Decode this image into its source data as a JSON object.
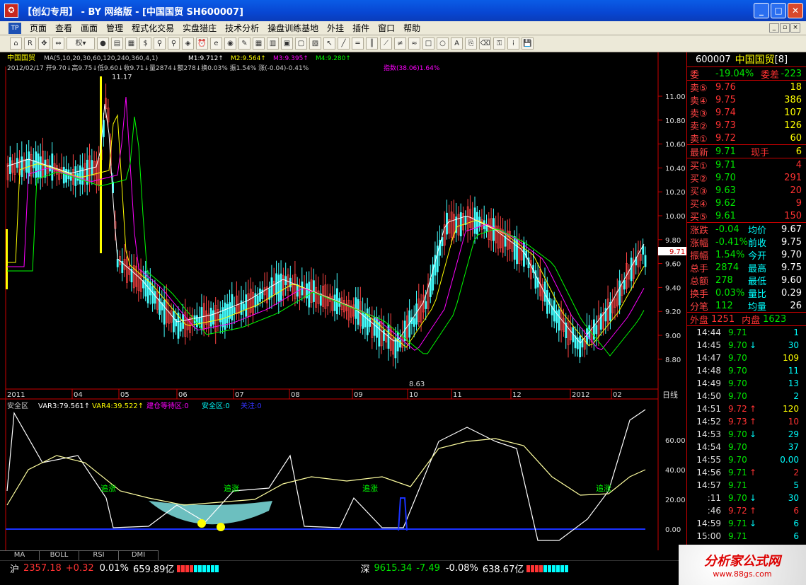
{
  "window": {
    "title": "【创幻专用】 - BY 网络版 - [中国国贸 SH600007]",
    "icon": "gear-app-icon"
  },
  "menu": [
    "页面",
    "查看",
    "画面",
    "管理",
    "程式化交易",
    "实盘猎庄",
    "技术分析",
    "操盘训练基地",
    "外挂",
    "插件",
    "窗口",
    "帮助"
  ],
  "toolbar": {
    "right_select": "权"
  },
  "main_header": {
    "line1_name": "中国国贸",
    "line1_ma": "MA(5,10,20,30,60,120,240,360,4,1)",
    "m1": "M1:9.712↑",
    "m2": "M2:9.564↑",
    "m3": "M3:9.395↑",
    "m4": "M4:9.280↑",
    "line2": "2012/02/17 开9.70↓高9.75↓低9.60↓收9.71↓量2874↓额278↓换0.03% 振1.54% 涨(-0.04)-0.41%",
    "line2_idx": "指数(38.06)1.64%"
  },
  "price_axis": [
    "11.00",
    "10.80",
    "10.60",
    "10.40",
    "10.20",
    "10.00",
    "9.80",
    "9.60",
    "9.40",
    "9.20",
    "9.00",
    "8.80"
  ],
  "price_tag": "9.71",
  "max_label": "11.17",
  "min_label": "8.63",
  "time_axis": [
    "2011",
    "04",
    "05",
    "06",
    "07",
    "08",
    "09",
    "10",
    "11",
    "12",
    "2012",
    "02"
  ],
  "period": "日线",
  "sub_header": {
    "name": "安全区",
    "var3": "VAR3:79.561↑",
    "var4": "VAR4:39.522↑",
    "wait": "建仓等待区:0",
    "safe": "安全区:0",
    "focus": "关注:0"
  },
  "sub_axis": [
    "60.00",
    "40.00",
    "20.00",
    "0.00"
  ],
  "sub_labels": [
    "追涨",
    "追涨",
    "追涨",
    "追涨"
  ],
  "tabs": [
    "MA",
    "BOLL",
    "RSI",
    "DMI"
  ],
  "quote": {
    "code": "600007",
    "name": "中国国贸",
    "tail": "[8]",
    "weibi_label": "委",
    "weibi": "-19.04%",
    "weicha_label": "委差",
    "weicha": "-223",
    "asks": [
      {
        "l": "卖⑤",
        "p": "9.76",
        "q": "18"
      },
      {
        "l": "卖④",
        "p": "9.75",
        "q": "386"
      },
      {
        "l": "卖③",
        "p": "9.74",
        "q": "107"
      },
      {
        "l": "卖②",
        "p": "9.73",
        "q": "126"
      },
      {
        "l": "卖①",
        "p": "9.72",
        "q": "60"
      }
    ],
    "last_label": "最新",
    "last": "9.71",
    "now_label": "现手",
    "now": "6",
    "bids": [
      {
        "l": "买①",
        "p": "9.71",
        "q": "4"
      },
      {
        "l": "买②",
        "p": "9.70",
        "q": "291"
      },
      {
        "l": "买③",
        "p": "9.63",
        "q": "20"
      },
      {
        "l": "买④",
        "p": "9.62",
        "q": "9"
      },
      {
        "l": "买⑤",
        "p": "9.61",
        "q": "150"
      }
    ],
    "stats": [
      [
        "涨跌",
        "-0.04",
        "均价",
        "9.67"
      ],
      [
        "涨幅",
        "-0.41%",
        "前收",
        "9.75"
      ],
      [
        "振幅",
        "1.54%",
        "今开",
        "9.70"
      ],
      [
        "总手",
        "2874",
        "最高",
        "9.75"
      ],
      [
        "总额",
        "278",
        "最低",
        "9.60"
      ],
      [
        "换手",
        "0.03%",
        "量比",
        "0.29"
      ],
      [
        "分笔",
        "112",
        "均量",
        "26"
      ]
    ],
    "outer_label": "外盘",
    "outer": "1251",
    "inner_label": "内盘",
    "inner": "1623",
    "ticks": [
      [
        "14:44",
        "9.71",
        "",
        "1"
      ],
      [
        "14:45",
        "9.70",
        "↓",
        "30"
      ],
      [
        "14:47",
        "9.70",
        "",
        "109"
      ],
      [
        "14:48",
        "9.70",
        "",
        "11"
      ],
      [
        "14:49",
        "9.70",
        "",
        "13"
      ],
      [
        "14:50",
        "9.70",
        "",
        "2"
      ],
      [
        "14:51",
        "9.72",
        "↑",
        "120"
      ],
      [
        "14:52",
        "9.73",
        "↑",
        "10"
      ],
      [
        "14:53",
        "9.70",
        "↓",
        "29"
      ],
      [
        "14:54",
        "9.70",
        "",
        "37"
      ],
      [
        "14:55",
        "9.70",
        "",
        "0.00"
      ],
      [
        "14:56",
        "9.71",
        "↑",
        "2"
      ],
      [
        "14:57",
        "9.71",
        "",
        "5"
      ],
      [
        ":11",
        "9.70",
        "↓",
        "30"
      ],
      [
        ":46",
        "9.72",
        "↑",
        "6"
      ],
      [
        "14:59",
        "9.71",
        "↓",
        "6"
      ],
      [
        "15:00",
        "9.71",
        "",
        "6"
      ]
    ]
  },
  "status": {
    "sh_label": "沪",
    "sh_index": "2357.18",
    "sh_chg": "+0.32",
    "sh_pct": "0.01%",
    "sh_amt": "659.89亿",
    "sz_label": "深",
    "sz_index": "9615.34",
    "sz_chg": "-7.49",
    "sz_pct": "-0.08%",
    "sz_amt": "638.67亿"
  },
  "watermark": {
    "brand": "分析家公式网",
    "url": "www.88gs.com"
  }
}
